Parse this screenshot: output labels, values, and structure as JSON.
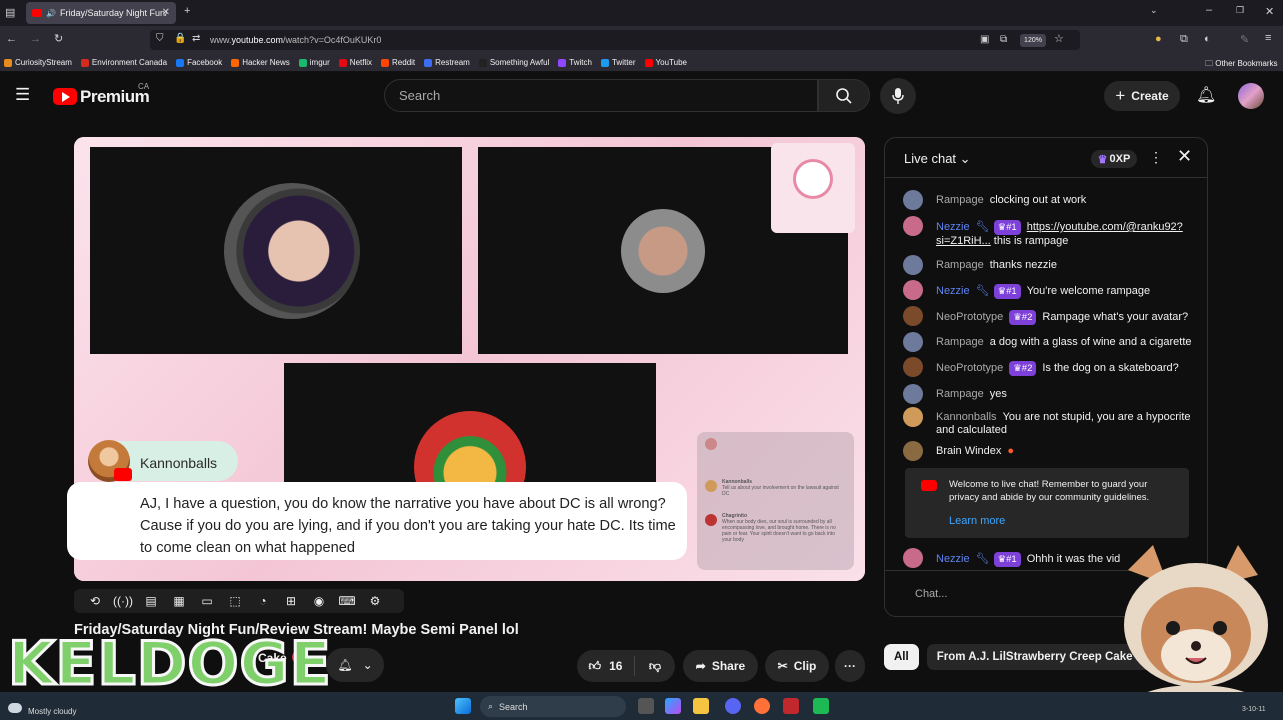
{
  "browser": {
    "tab_title": "Friday/Saturday Night Fun/",
    "url_prefix": "www.",
    "url_domain": "youtube.com",
    "url_path": "/watch?v=Oc4fOuKUKr0",
    "zoom": "120%",
    "bookmarks": [
      {
        "label": "CuriosityStream",
        "color": "#e88c1e"
      },
      {
        "label": "Environment Canada",
        "color": "#d52b1e"
      },
      {
        "label": "Facebook",
        "color": "#1877f2"
      },
      {
        "label": "Hacker News",
        "color": "#ff6600"
      },
      {
        "label": "imgur",
        "color": "#1bb76e"
      },
      {
        "label": "Netflix",
        "color": "#e50914"
      },
      {
        "label": "Reddit",
        "color": "#ff4500"
      },
      {
        "label": "Restream",
        "color": "#3d6cf5"
      },
      {
        "label": "Something Awful",
        "color": "#222222"
      },
      {
        "label": "Twitch",
        "color": "#9146ff"
      },
      {
        "label": "Twitter",
        "color": "#1d9bf0"
      },
      {
        "label": "YouTube",
        "color": "#ff0000"
      }
    ],
    "other_bookmarks": "Other Bookmarks"
  },
  "header": {
    "logo": "Premium",
    "region": "CA",
    "search_placeholder": "Search",
    "create_label": "Create"
  },
  "video": {
    "overlay_name": "Kannonballs",
    "overlay_message": "AJ, I have a question, you do know the narrative you have about DC is all wrong? Cause if you do you are lying, and if you don't you are taking your hate DC. Its time to come clean on what happened",
    "mini_chat": [
      {
        "name": "Kannonballs",
        "text": "Tell us about your involvement on the lawsuit against DC"
      },
      {
        "name": "Chagrinito",
        "text": "When our body dies, our soul is surrounded by all encompassing love, and brought home. There is no pain or fear. Your spirit doesn't want to go back into your body"
      }
    ],
    "title": "Friday/Saturday Night Fun/Review Stream! Maybe Semi Panel lol",
    "channel": "Cake",
    "likes": "16",
    "share_label": "Share",
    "clip_label": "Clip"
  },
  "chat": {
    "title": "Live chat",
    "xp": "0XP",
    "messages": [
      {
        "author": "Rampage",
        "mod": false,
        "badge": "",
        "text": "clocking out at work",
        "link": "",
        "avatar": "#6d7a9c"
      },
      {
        "author": "Nezzie",
        "mod": true,
        "badge": "#1",
        "text": "this is rampage",
        "link": "https://youtube.com/@ranku92?si=Z1RiH...",
        "avatar": "#c86b8a"
      },
      {
        "author": "Rampage",
        "mod": false,
        "badge": "",
        "text": "thanks nezzie",
        "link": "",
        "avatar": "#6d7a9c"
      },
      {
        "author": "Nezzie",
        "mod": true,
        "badge": "#1",
        "text": "You're welcome rampage",
        "link": "",
        "avatar": "#c86b8a"
      },
      {
        "author": "NeoPrototype",
        "mod": false,
        "badge": "#2",
        "text": "Rampage what's your avatar?",
        "link": "",
        "avatar": "#7a4a2a"
      },
      {
        "author": "Rampage",
        "mod": false,
        "badge": "",
        "text": "a dog with a glass of wine and a cigarette",
        "link": "",
        "avatar": "#6d7a9c"
      },
      {
        "author": "NeoPrototype",
        "mod": false,
        "badge": "#2",
        "text": "Is the dog on a skateboard?",
        "link": "",
        "avatar": "#7a4a2a"
      },
      {
        "author": "Rampage",
        "mod": false,
        "badge": "",
        "text": "yes",
        "link": "",
        "avatar": "#6d7a9c"
      },
      {
        "author": "Kannonballs",
        "mod": false,
        "badge": "",
        "text": "You are not stupid, you are a hypocrite and calculated",
        "link": "",
        "avatar": "#d09a5a"
      },
      {
        "author": "Brain Windex",
        "mod": false,
        "badge": "",
        "text": "",
        "link": "",
        "avatar": "#8a6a40"
      }
    ],
    "welcome": "Welcome to live chat! Remember to guard your privacy and abide by our community guidelines.",
    "learn_more": "Learn more",
    "pinned_last": {
      "author": "Nezzie",
      "badge": "#1",
      "text": "Ohhh it was the vid"
    },
    "input_placeholder": "Chat..."
  },
  "chips": [
    "All",
    "From A.J. LilStrawberry Creep Cake"
  ],
  "overlays": {
    "streamer_logo": "KELDOGE"
  },
  "taskbar": {
    "weather": "Mostly cloudy",
    "search": "Search",
    "date": "3-10-11"
  }
}
